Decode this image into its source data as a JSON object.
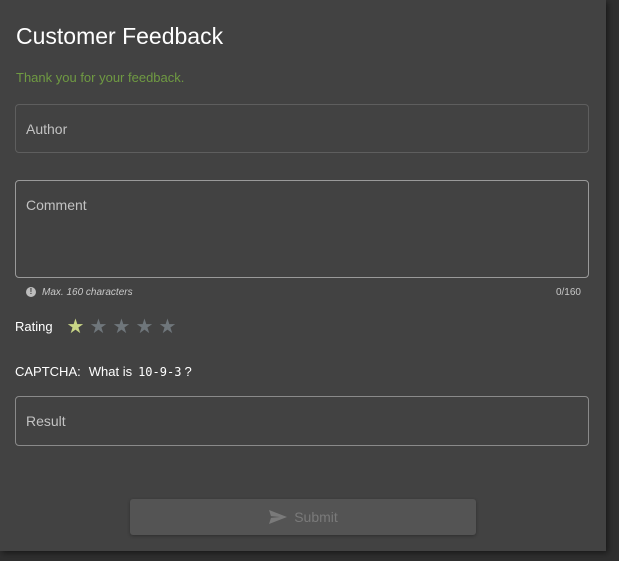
{
  "form": {
    "title": "Customer Feedback",
    "confirmation": "Thank you for your feedback.",
    "author": {
      "placeholder": "Author",
      "value": ""
    },
    "comment": {
      "placeholder": "Comment",
      "value": "",
      "hint": "Max. 160 characters",
      "counter": "0/160",
      "hint_icon": "info-icon"
    },
    "rating": {
      "label": "Rating",
      "value": 1,
      "max": 5,
      "filled_color": "#c9d686",
      "empty_color": "#6f767b"
    },
    "captcha": {
      "label": "CAPTCHA:",
      "question": "What is",
      "expression": "10-9-3",
      "question_mark": "?"
    },
    "result": {
      "placeholder": "Result",
      "value": ""
    },
    "submit": {
      "label": "Submit",
      "icon": "send-icon",
      "disabled": true
    }
  },
  "colors": {
    "background": "#424242",
    "confirmation": "#6f9a42"
  }
}
